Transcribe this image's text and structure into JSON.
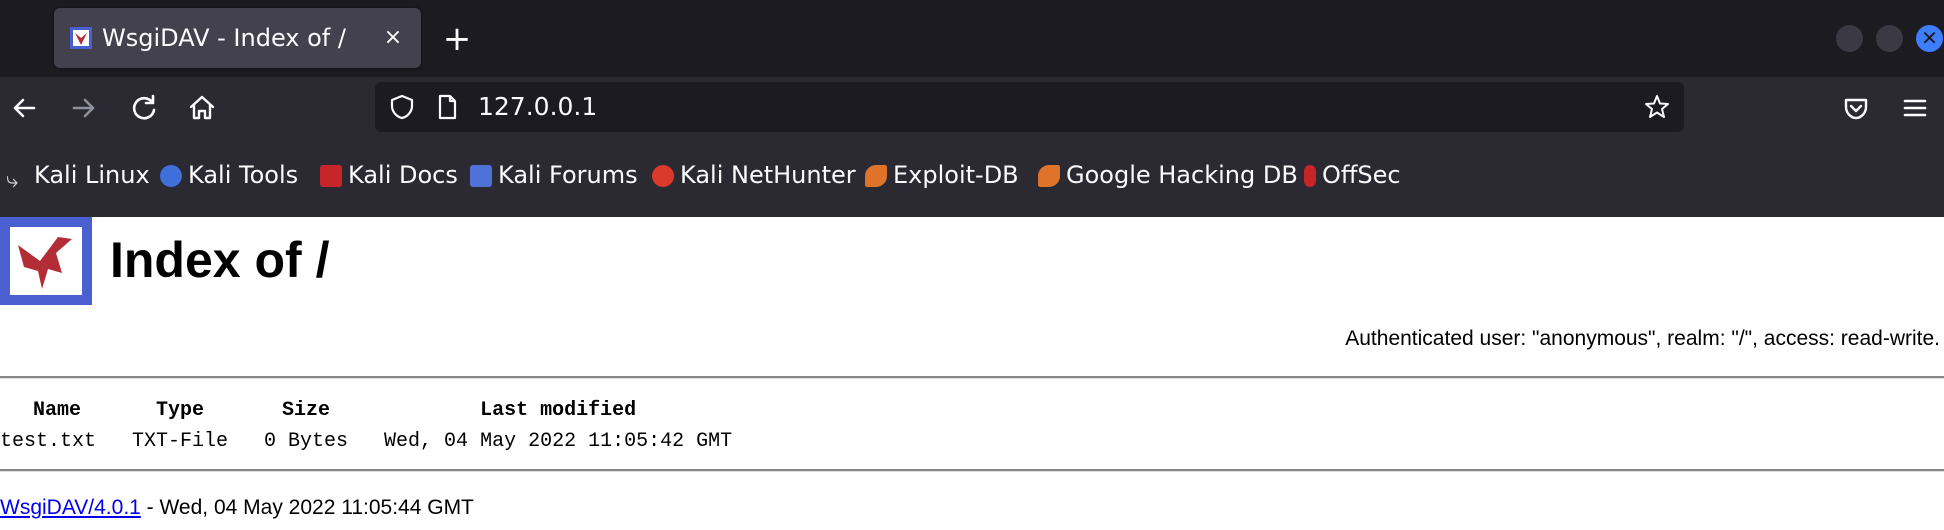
{
  "browser": {
    "tab": {
      "title": "WsgiDAV - Index of /",
      "close": "×"
    },
    "new_tab": "+",
    "window_close": "✕",
    "url": "127.0.0.1",
    "bookmarks": [
      {
        "label": "Kali Linux",
        "icon": "kali-dragon-icon",
        "color": "#9a9a9a"
      },
      {
        "label": "Kali Tools",
        "icon": "kali-tools-icon",
        "color": "#3f6fd9"
      },
      {
        "label": "Kali Docs",
        "icon": "kali-docs-icon",
        "color": "#c8252b"
      },
      {
        "label": "Kali Forums",
        "icon": "kali-forums-icon",
        "color": "#4f72d6"
      },
      {
        "label": "Kali NetHunter",
        "icon": "kali-nethunter-icon",
        "color": "#d93a2b"
      },
      {
        "label": "Exploit-DB",
        "icon": "exploit-db-icon",
        "color": "#e0732a"
      },
      {
        "label": "Google Hacking DB",
        "icon": "ghdb-icon",
        "color": "#e0732a"
      },
      {
        "label": "OffSec",
        "icon": "offsec-icon",
        "color": "#c8252b"
      }
    ]
  },
  "page": {
    "title": "Index of /",
    "auth": "Authenticated user: \"anonymous\", realm: \"/\", access: read-write.",
    "columns": {
      "name": "Name",
      "type": "Type",
      "size": "Size",
      "modified": "Last modified"
    },
    "rows": [
      {
        "name": "test.txt",
        "type": "TXT-File",
        "size": "0 Bytes",
        "modified": "Wed, 04 May 2022 11:05:42 GMT"
      }
    ],
    "footer": {
      "link": "WsgiDAV/4.0.1",
      "text": " - Wed, 04 May 2022 11:05:44 GMT"
    }
  },
  "colors": {
    "tabbar_bg": "#1c1b22",
    "navbar_bg": "#2b2a33",
    "logo_bg": "#4a5fd0",
    "logo_bird": "#b32d36",
    "link": "#0000ee"
  }
}
